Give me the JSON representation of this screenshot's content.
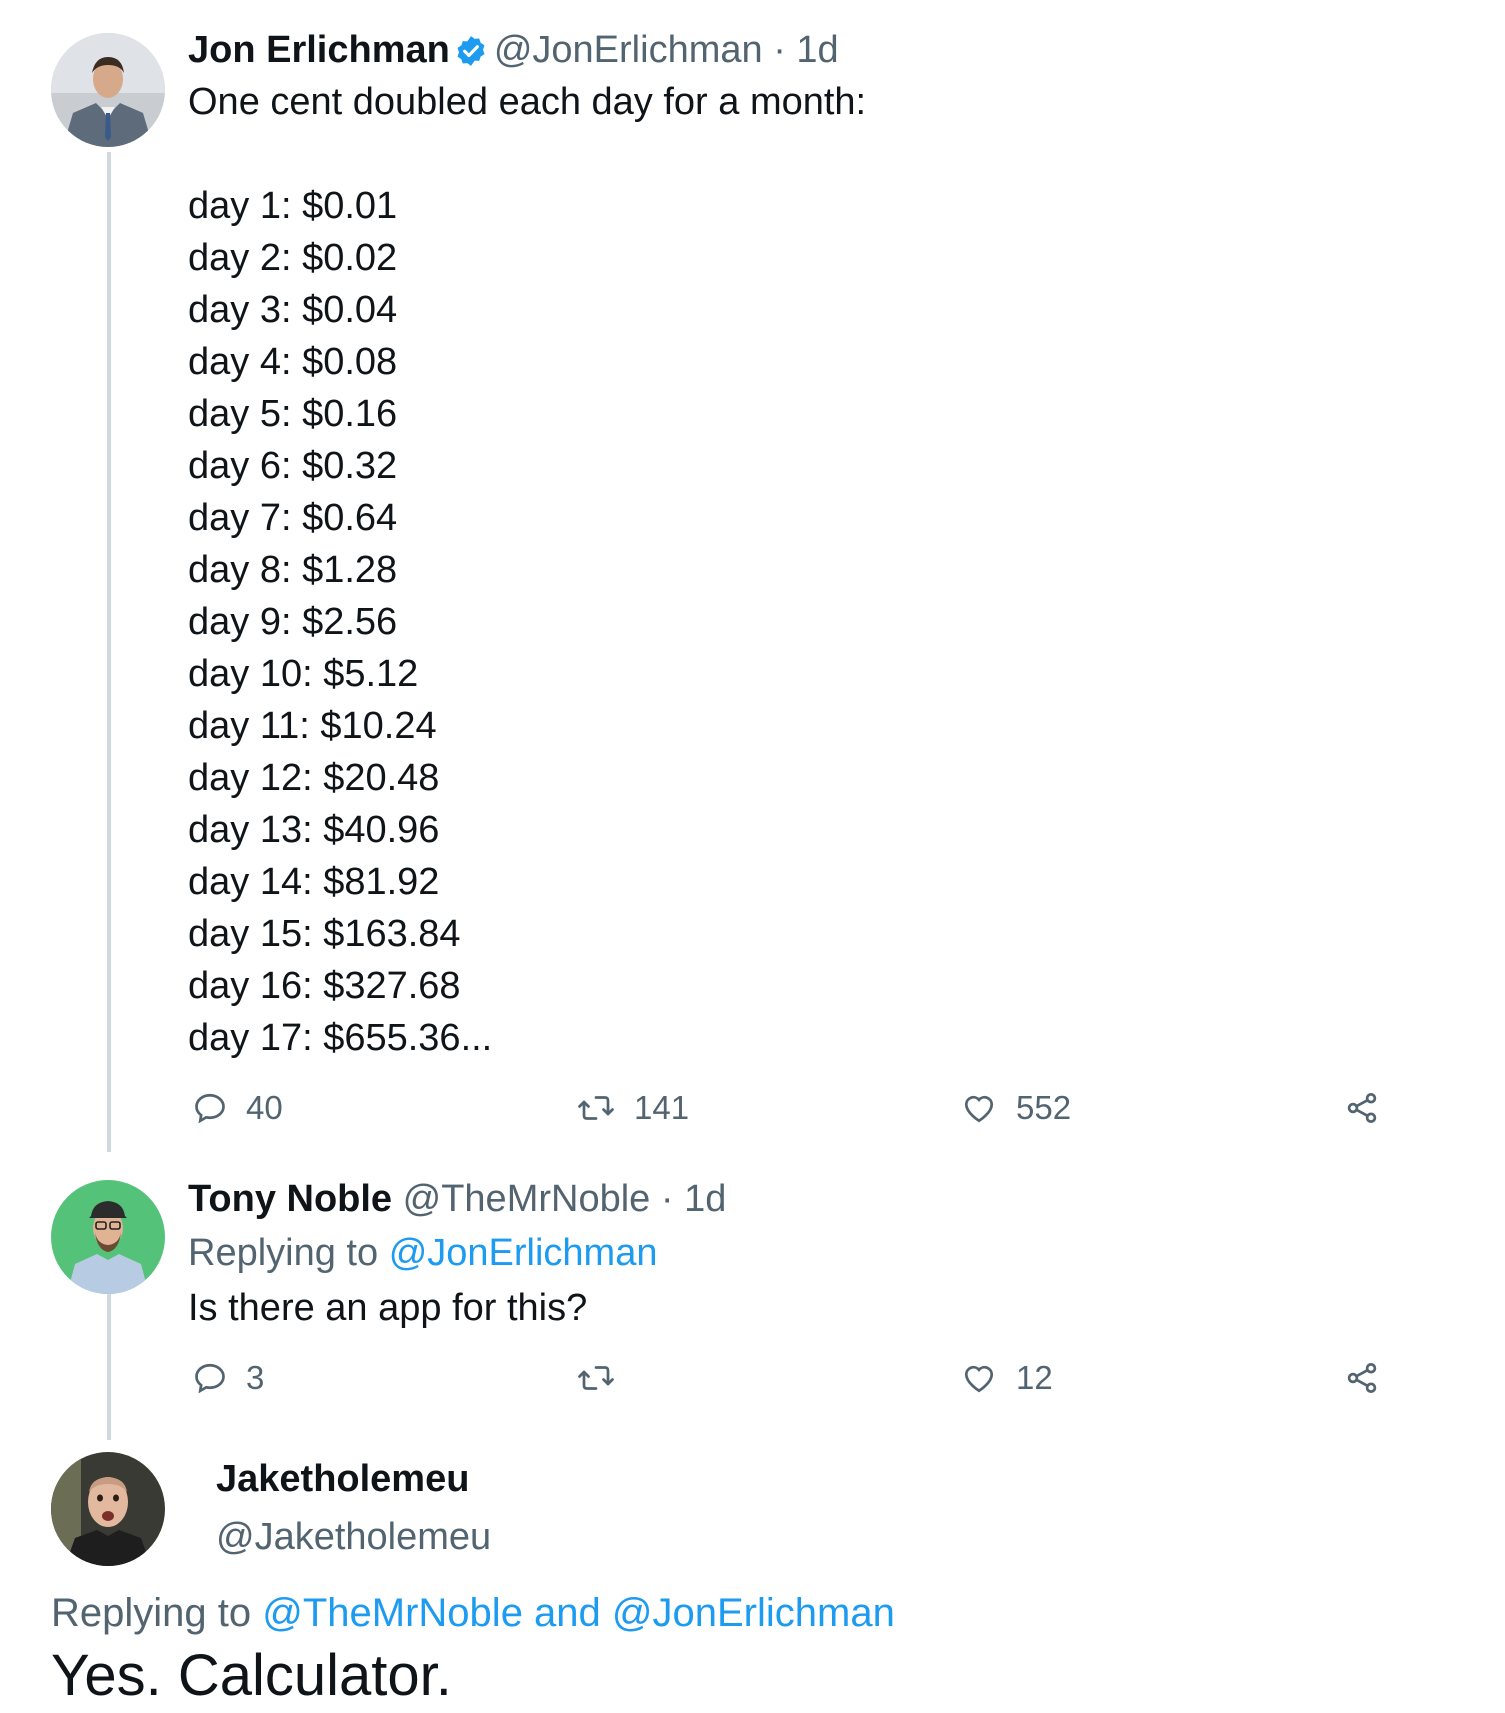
{
  "tweet1": {
    "name": "Jon Erlichman",
    "handle": "@JonErlichman",
    "time": "· 1d",
    "intro": "One cent doubled each day for a month:",
    "lines": [
      "day 1: $0.01",
      "day 2: $0.02",
      "day 3: $0.04",
      "day 4: $0.08",
      "day 5: $0.16",
      "day 6: $0.32",
      "day 7: $0.64",
      "day 8: $1.28",
      "day 9: $2.56",
      "day 10: $5.12",
      "day 11: $10.24",
      "day 12: $20.48",
      "day 13: $40.96",
      "day 14: $81.92",
      "day 15: $163.84",
      "day 16: $327.68",
      "day 17: $655.36..."
    ],
    "replies": "40",
    "retweets": "141",
    "likes": "552"
  },
  "tweet2": {
    "name": "Tony Noble",
    "handle": "@TheMrNoble",
    "time": "· 1d",
    "replying_prefix": "Replying to",
    "replying_to": "@JonErlichman",
    "text": "Is there an app for this?",
    "replies": "3",
    "retweets": "",
    "likes": "12"
  },
  "tweet3": {
    "name": "Jaketholemeu",
    "handle": "@Jaketholemeu",
    "replying_prefix": "Replying to",
    "replying_to": "@TheMrNoble and @JonErlichman",
    "text": "Yes. Calculator."
  },
  "colors": {
    "text": "#0f1419",
    "secondary": "#536471",
    "link": "#1d9bf0",
    "thread": "#cfd9de"
  },
  "icons": {
    "verified": "verified-badge-icon",
    "reply": "reply-bubble-icon",
    "retweet": "retweet-icon",
    "like": "heart-icon",
    "share": "share-icon"
  }
}
